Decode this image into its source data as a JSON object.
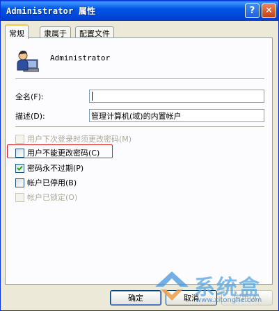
{
  "window": {
    "title": "Administrator 属性",
    "help_glyph": "?",
    "close_glyph": "✕"
  },
  "tabs": [
    {
      "label": "常规",
      "active": true
    },
    {
      "label": "隶属于",
      "active": false
    },
    {
      "label": "配置文件",
      "active": false
    }
  ],
  "user": {
    "name": "Administrator",
    "icon": "user-computer-icon"
  },
  "fields": {
    "fullname_label": "全名(F):",
    "fullname_value": "",
    "description_label": "描述(D):",
    "description_value": "管理计算机(域)的内置帐户"
  },
  "options": [
    {
      "label": "用户下次登录时须更改密码(M)",
      "checked": false,
      "enabled": false
    },
    {
      "label": "用户不能更改密码(C)",
      "checked": false,
      "enabled": true,
      "highlighted": true
    },
    {
      "label": "密码永不过期(P)",
      "checked": true,
      "enabled": true
    },
    {
      "label": "帐户已停用(B)",
      "checked": false,
      "enabled": true
    },
    {
      "label": "帐户已锁定(O)",
      "checked": false,
      "enabled": false
    }
  ],
  "buttons": {
    "ok": "确定",
    "cancel": "取消",
    "apply": "应用(A)"
  },
  "watermark": {
    "text": "系统盒",
    "url": "www.xitonghe.com"
  },
  "colors": {
    "titlebar": "#0054E3",
    "highlight_box": "#E02020",
    "tab_accent": "#FFC83C"
  }
}
